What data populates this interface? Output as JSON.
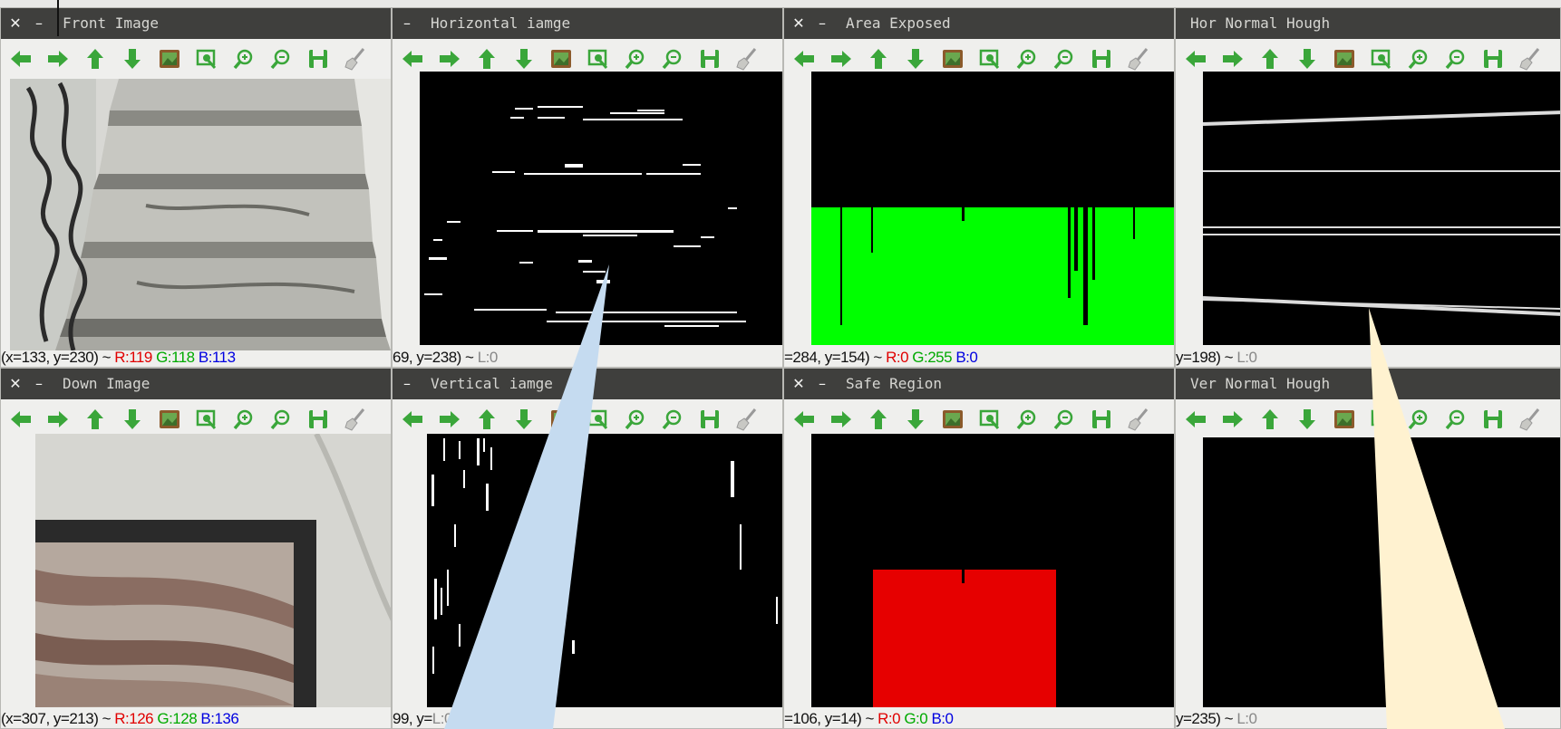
{
  "windows": [
    {
      "id": "front",
      "title": "Front Image",
      "status_coords": "(x=133, y=230) ~ ",
      "r": "R:119",
      "g": "G:118",
      "b": "B:113"
    },
    {
      "id": "horiz",
      "title": "Horizontal iamge",
      "status_coords": "69, y=238) ~ ",
      "l": "L:0"
    },
    {
      "id": "area",
      "title": "Area Exposed",
      "status_coords": "=284, y=154) ~ ",
      "r": "R:0",
      "g": "G:255",
      "b": "B:0"
    },
    {
      "id": "hough_h",
      "title": "Hor Normal Hough",
      "status_coords": "y=198) ~ ",
      "l": "L:0"
    },
    {
      "id": "down",
      "title": "Down Image",
      "status_coords": "(x=307, y=213) ~ ",
      "r": "R:126",
      "g": "G:128",
      "b": "B:136"
    },
    {
      "id": "vert",
      "title": "Vertical iamge",
      "status_coords": "99, y=",
      "l": "L:0"
    },
    {
      "id": "safe",
      "title": "Safe Region",
      "status_coords": "=106, y=14) ~ ",
      "r": "R:0",
      "g": "G:0",
      "b": "B:0"
    },
    {
      "id": "hough_v",
      "title": "Ver Normal Hough",
      "status_coords": "y=235) ~ ",
      "l": "L:0"
    }
  ],
  "toolbar_icons": [
    "arrow-left-icon",
    "arrow-right-icon",
    "arrow-up-icon",
    "arrow-down-icon",
    "image-icon",
    "zoom-fit-icon",
    "zoom-in-icon",
    "zoom-out-icon",
    "save-icon",
    "clear-brush-icon"
  ],
  "colors": {
    "titlebar": "#3f3f3d",
    "arrow": "#3aa63a",
    "exposed_area": "#00ff00",
    "safe_region": "#e60000",
    "callout_blue": "#c5dbf0",
    "callout_yellow": "#fff2d0"
  }
}
